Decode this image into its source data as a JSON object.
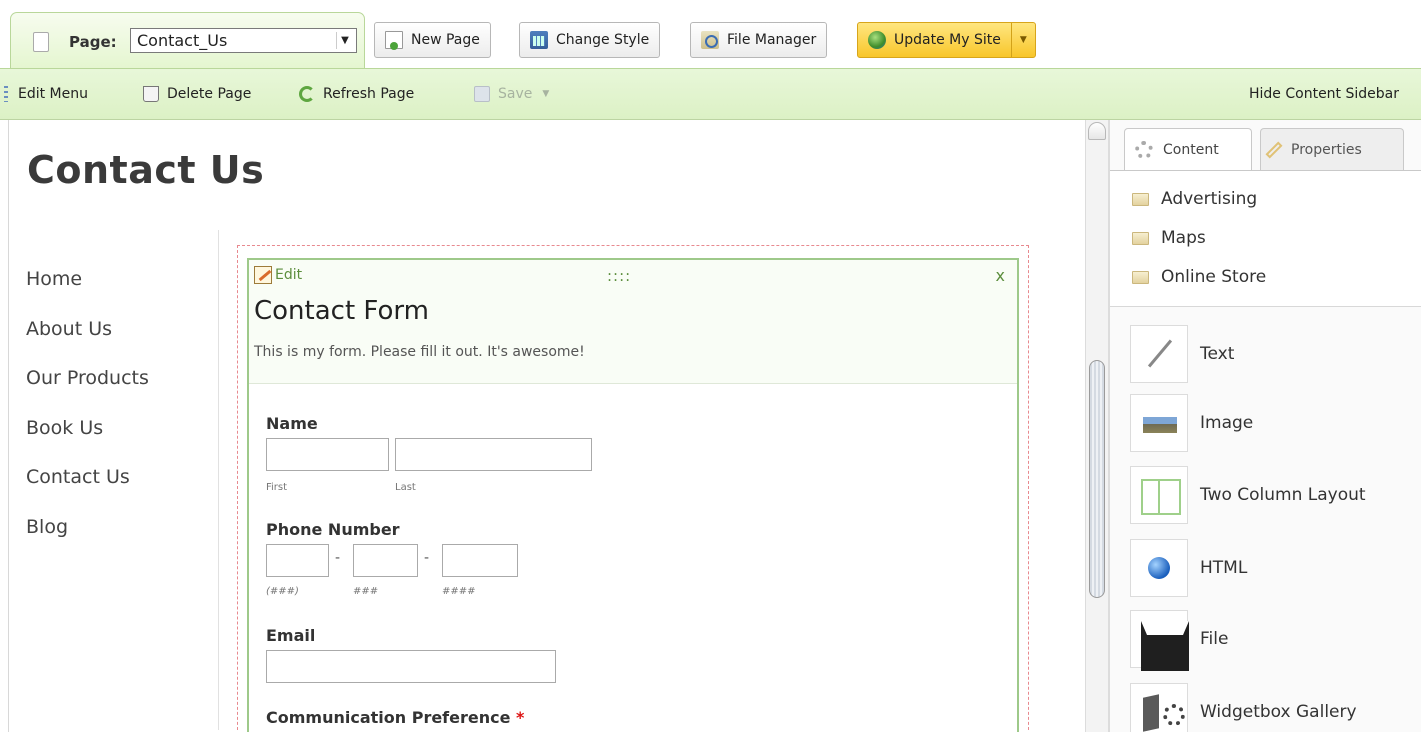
{
  "topbar": {
    "page_label": "Page:",
    "page_select_value": "Contact_Us",
    "new_page": "New Page",
    "change_style": "Change Style",
    "file_manager": "File Manager",
    "update_my_site": "Update My Site"
  },
  "toolbar": {
    "edit_menu": "Edit Menu",
    "delete_page": "Delete Page",
    "refresh_page": "Refresh Page",
    "save": "Save",
    "hide_sidebar": "Hide Content Sidebar"
  },
  "page": {
    "title": "Contact Us",
    "nav": [
      "Home",
      "About Us",
      "Our Products",
      "Book Us",
      "Contact Us",
      "Blog"
    ]
  },
  "form": {
    "edit_label": "Edit",
    "drag_handle": "::::",
    "close": "x",
    "title": "Contact Form",
    "description": "This is my form. Please fill it out. It's awesome!",
    "name_label": "Name",
    "first_sub": "First",
    "last_sub": "Last",
    "phone_label": "Phone Number",
    "phone_dash": "-",
    "phone_sub_1": "(###)",
    "phone_sub_2": "###",
    "phone_sub_3": "####",
    "email_label": "Email",
    "comm_label": "Communication Preference",
    "required_marker": "*"
  },
  "sidebar": {
    "tab_content": "Content",
    "tab_properties": "Properties",
    "categories": [
      "Advertising",
      "Maps",
      "Online Store"
    ],
    "elements": [
      "Text",
      "Image",
      "Two Column Layout",
      "HTML",
      "File",
      "Widgetbox Gallery"
    ]
  },
  "colors": {
    "toolbar_green": "#dcf1c5",
    "update_button": "#f8c62a",
    "form_border": "#9ec98a",
    "required_red": "#dd1111"
  }
}
